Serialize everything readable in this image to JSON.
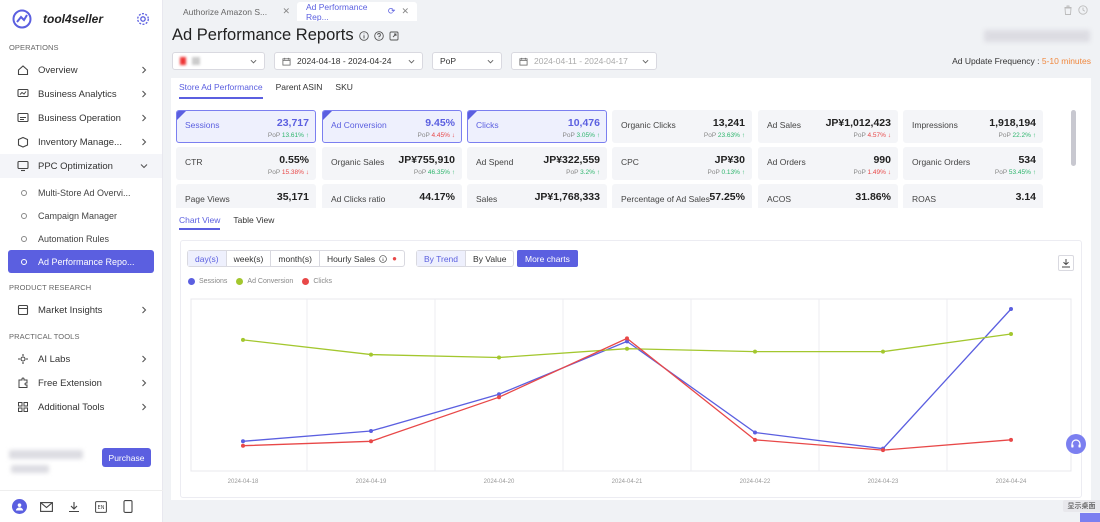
{
  "app": {
    "name": "tool4seller"
  },
  "sidebar": {
    "sections": {
      "operations": "OPERATIONS",
      "product_research": "PRODUCT RESEARCH",
      "practical_tools": "PRACTICAL TOOLS"
    },
    "items": [
      {
        "label": "Overview",
        "icon": "home-icon"
      },
      {
        "label": "Business Analytics",
        "icon": "analytics-icon"
      },
      {
        "label": "Business Operation",
        "icon": "operation-icon"
      },
      {
        "label": "Inventory Manage...",
        "icon": "inventory-icon"
      },
      {
        "label": "PPC Optimization",
        "icon": "monitor-icon"
      }
    ],
    "sub_items": [
      {
        "label": "Multi-Store Ad Overvi..."
      },
      {
        "label": "Campaign Manager"
      },
      {
        "label": "Automation Rules"
      },
      {
        "label": "Ad Performance Repo..."
      }
    ],
    "research": [
      {
        "label": "Market Insights",
        "icon": "insights-icon"
      }
    ],
    "tools": [
      {
        "label": "AI Labs",
        "icon": "ai-icon"
      },
      {
        "label": "Free Extension",
        "icon": "extension-icon"
      },
      {
        "label": "Additional Tools",
        "icon": "grid-icon"
      }
    ],
    "purchase_label": "Purchase"
  },
  "tabs": [
    {
      "label": "Authorize Amazon S..."
    },
    {
      "label": "Ad Performance Rep..."
    }
  ],
  "page": {
    "title": "Ad Performance Reports",
    "date_range": "2024-04-18 - 2024-04-24",
    "compare_mode": "PoP",
    "compare_range": "2024-04-11 - 2024-04-17",
    "freq_label": "Ad Update Frequency :",
    "freq_value": "5-10 minutes"
  },
  "subtabs": [
    "Store Ad Performance",
    "Parent ASIN",
    "SKU"
  ],
  "metrics": [
    {
      "name": "Sessions",
      "value": "23,717",
      "pop": "13.61%",
      "dir": "up",
      "selected": true
    },
    {
      "name": "Ad Conversion",
      "value": "9.45%",
      "pop": "4.45%",
      "dir": "down",
      "selected": true
    },
    {
      "name": "Clicks",
      "value": "10,476",
      "pop": "3.05%",
      "dir": "up",
      "selected": true
    },
    {
      "name": "Organic Clicks",
      "value": "13,241",
      "pop": "23.63%",
      "dir": "up"
    },
    {
      "name": "Ad Sales",
      "value": "JP¥1,012,423",
      "pop": "4.57%",
      "dir": "down"
    },
    {
      "name": "Impressions",
      "value": "1,918,194",
      "pop": "22.2%",
      "dir": "up"
    },
    {
      "name": "CTR",
      "value": "0.55%",
      "pop": "15.38%",
      "dir": "down"
    },
    {
      "name": "Organic Sales",
      "value": "JP¥755,910",
      "pop": "46.35%",
      "dir": "up"
    },
    {
      "name": "Ad Spend",
      "value": "JP¥322,559",
      "pop": "3.2%",
      "dir": "up"
    },
    {
      "name": "CPC",
      "value": "JP¥30",
      "pop": "0.13%",
      "dir": "up"
    },
    {
      "name": "Ad Orders",
      "value": "990",
      "pop": "1.49%",
      "dir": "down"
    },
    {
      "name": "Organic Orders",
      "value": "534",
      "pop": "53.45%",
      "dir": "up"
    },
    {
      "name": "Page Views",
      "value": "35,171",
      "pop": "",
      "dir": ""
    },
    {
      "name": "Ad Clicks ratio",
      "value": "44.17%",
      "pop": "",
      "dir": ""
    },
    {
      "name": "Sales",
      "value": "JP¥1,768,333",
      "pop": "",
      "dir": ""
    },
    {
      "name": "Percentage of Ad Sales",
      "value": "57.25%",
      "pop": "",
      "dir": ""
    },
    {
      "name": "ACOS",
      "value": "31.86%",
      "pop": "",
      "dir": ""
    },
    {
      "name": "ROAS",
      "value": "3.14",
      "pop": "",
      "dir": ""
    }
  ],
  "pop_label": "PoP",
  "views": [
    "Chart View",
    "Table View"
  ],
  "granularity": [
    "day(s)",
    "week(s)",
    "month(s)",
    "Hourly Sales"
  ],
  "modes": [
    "By Trend",
    "By Value"
  ],
  "more_charts": "More charts",
  "floating": {
    "desktop_label": "显示桌面"
  },
  "chart_data": {
    "type": "line",
    "x": [
      "2024-04-18",
      "2024-04-19",
      "2024-04-20",
      "2024-04-21",
      "2024-04-22",
      "2024-04-23",
      "2024-04-24"
    ],
    "series": [
      {
        "name": "Sessions",
        "color": "#5b5fe0",
        "values": [
          0.1,
          0.17,
          0.42,
          0.78,
          0.16,
          0.05,
          1.0
        ]
      },
      {
        "name": "Ad Conversion",
        "color": "#a3c72e",
        "values": [
          0.79,
          0.69,
          0.67,
          0.73,
          0.71,
          0.71,
          0.83
        ]
      },
      {
        "name": "Clicks",
        "color": "#e84848",
        "values": [
          0.07,
          0.1,
          0.4,
          0.8,
          0.11,
          0.04,
          0.11
        ]
      }
    ],
    "grid": "vertical"
  }
}
